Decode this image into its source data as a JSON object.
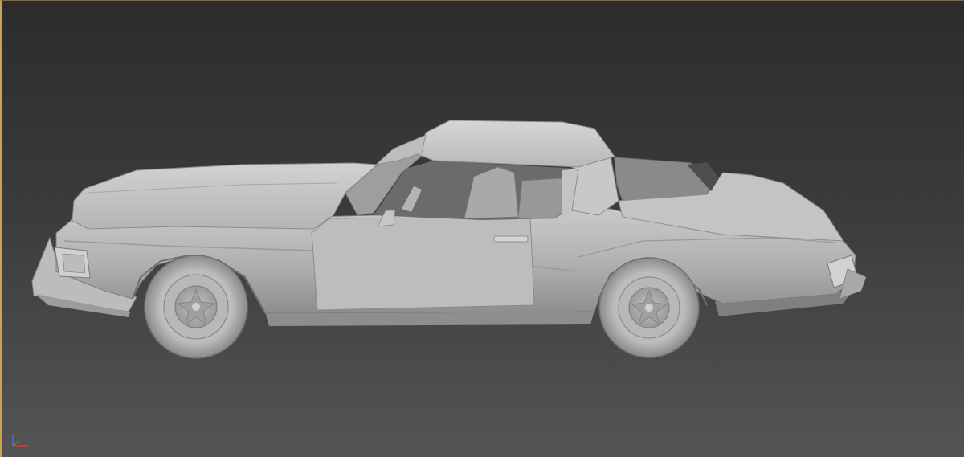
{
  "viewport": {
    "background_top": "#2c2c2c",
    "background_bottom": "#545454",
    "active_border_color": "#c8a25a",
    "view": "perspective",
    "shading": "default-shading"
  },
  "model": {
    "object": "car-model",
    "body_color": "#b4b4b4"
  },
  "gizmo": {
    "x_axis_color": "#d23c3c",
    "y_axis_color": "#3c9a3c",
    "z_axis_color": "#4a6ad2"
  }
}
